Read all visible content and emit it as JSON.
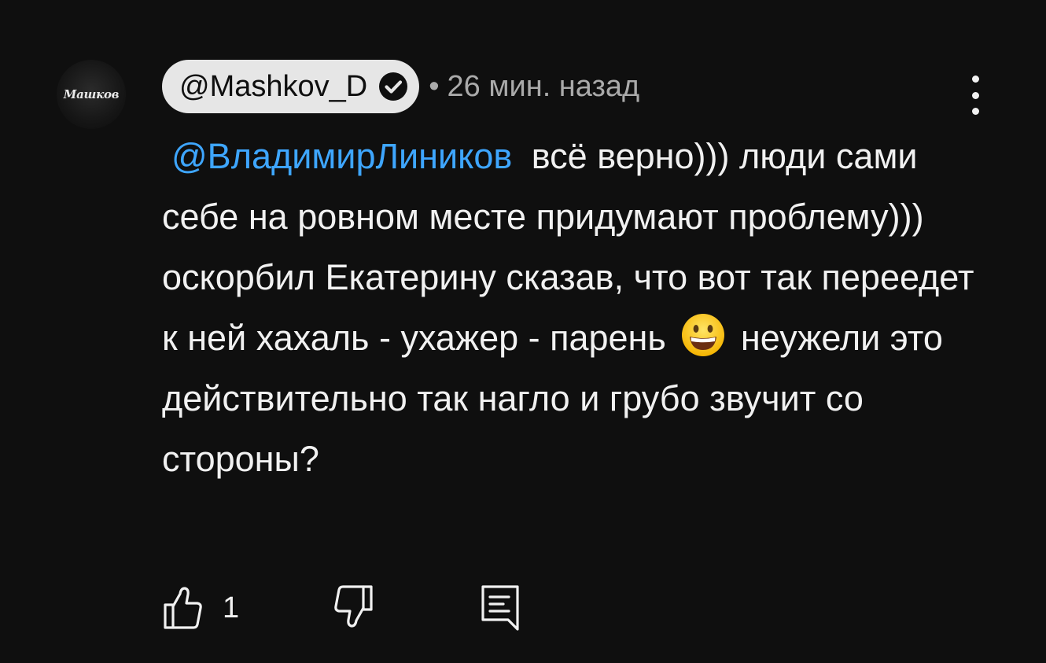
{
  "comment": {
    "avatar_text": "Машков",
    "author": "@Mashkov_D",
    "verified_icon": "check-circle-icon",
    "separator": "•",
    "timestamp": "26 мин. назад",
    "mention": "@ВладимирЛиников",
    "text_part1": "всё верно))) люди сами себе на ровном месте придумают проблему))) оскорбил Екатерину сказав, что вот так переедет к ней хахаль - ухажер - парень",
    "emoji": "grinning-face",
    "text_part2": "неужели это действительно так нагло и грубо звучит со стороны?",
    "like_count": "1"
  },
  "icons": {
    "menu": "more-vertical-icon",
    "like": "thumbs-up-icon",
    "dislike": "thumbs-down-icon",
    "reply": "comment-icon"
  },
  "colors": {
    "background": "#0f0f0f",
    "text": "#f1f1f1",
    "meta": "#aaaaaa",
    "mention": "#3ea6ff",
    "author_chip": "#e6e6e6"
  }
}
